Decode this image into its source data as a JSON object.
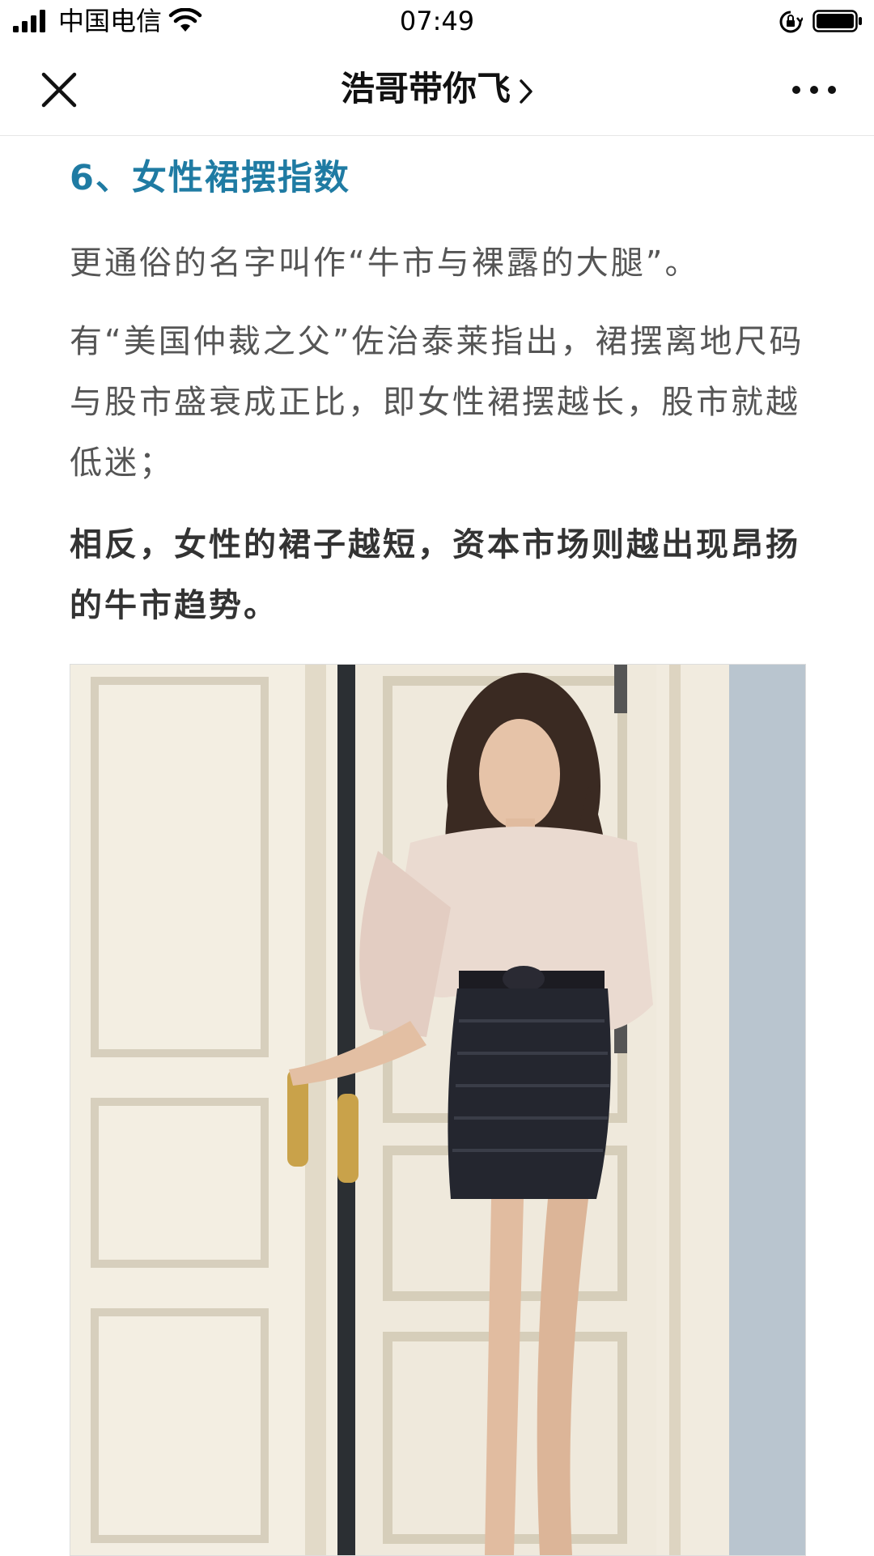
{
  "status_bar": {
    "carrier": "中国电信",
    "time": "07:49",
    "icons": [
      "signal-icon",
      "wifi-icon",
      "rotation-lock-icon",
      "battery-icon"
    ]
  },
  "nav": {
    "title": "浩哥带你飞",
    "icons": [
      "close-icon",
      "chevron-right-icon",
      "more-icon"
    ]
  },
  "article": {
    "heading": "6、女性裙摆指数",
    "paragraphs": [
      "更通俗的名字叫作“牛市与裸露的大腿”。",
      "有“美国仲裁之父”佐治泰莱指出，裙摆离地尺码与股市盛衰成正比，即女性裙摆越长，股市就越低迷；",
      "相反，女性的裙子越短，资本市场则越出现昂扬的牛市趋势。"
    ]
  },
  "colors": {
    "heading": "#1f7ba3",
    "body_text": "#555555",
    "bold_text": "#333333"
  }
}
